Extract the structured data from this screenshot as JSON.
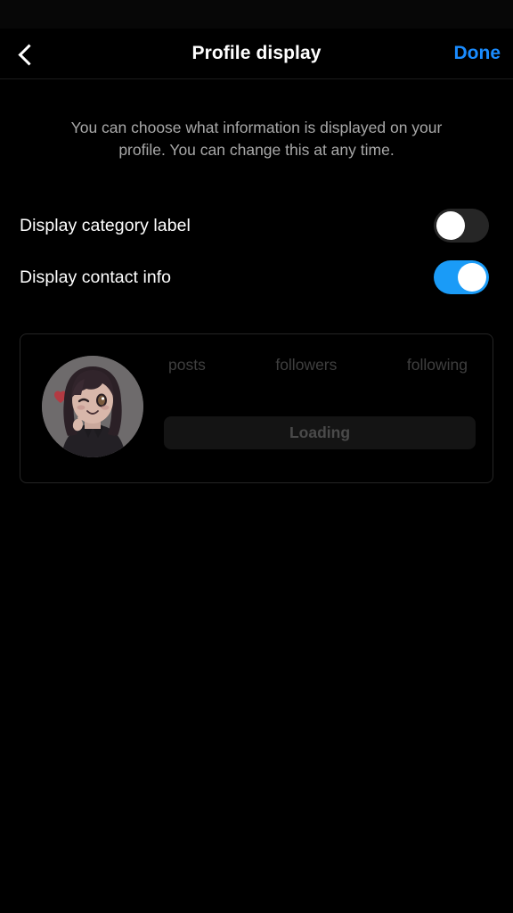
{
  "app": {
    "background_color": "#000000",
    "accent_color": "#1a8cff"
  },
  "header": {
    "back_icon": "chevron-left-icon",
    "title": "Profile display",
    "done_label": "Done"
  },
  "main": {
    "description": "You can choose what information is displayed on your profile. You can change this at any time."
  },
  "settings": {
    "rows": [
      {
        "label": "Display category label",
        "state": "off",
        "track_color": "#262626"
      },
      {
        "label": "Display contact info",
        "state": "on",
        "track_color": "#1a9bf7"
      }
    ]
  },
  "preview": {
    "avatar": {
      "icon": "avatar-image",
      "description": "anime girl illustration with dark hair, winking, red heart, dark hoodie"
    },
    "stats": [
      {
        "label": "posts"
      },
      {
        "label": "followers"
      },
      {
        "label": "following"
      }
    ],
    "action_button": {
      "label": "Loading"
    }
  }
}
